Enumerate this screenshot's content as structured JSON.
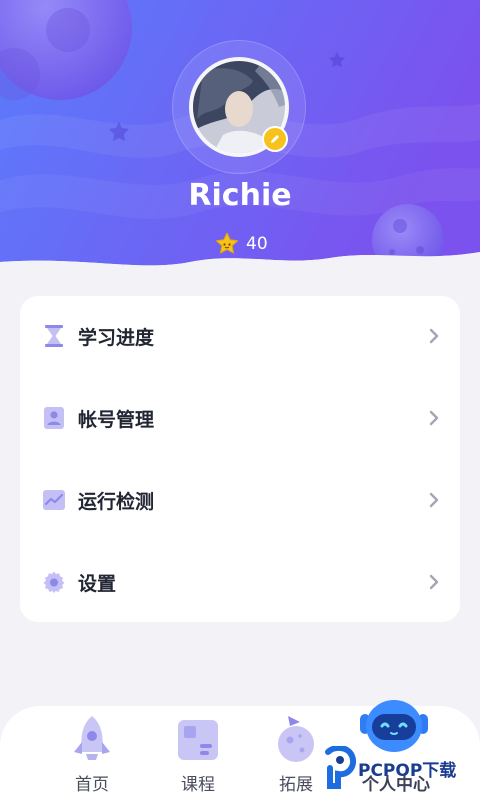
{
  "profile": {
    "username": "Richie",
    "stars": "40"
  },
  "menu": {
    "items": [
      {
        "label": "学习进度",
        "icon": "hourglass-icon"
      },
      {
        "label": "帐号管理",
        "icon": "user-card-icon"
      },
      {
        "label": "运行检测",
        "icon": "chart-line-icon"
      },
      {
        "label": "设置",
        "icon": "gear-icon"
      }
    ]
  },
  "nav": {
    "items": [
      {
        "label": "首页",
        "icon": "rocket-icon"
      },
      {
        "label": "课程",
        "icon": "course-book-icon"
      },
      {
        "label": "拓展",
        "icon": "planet-flag-icon"
      },
      {
        "label": "个人中心",
        "icon": "robot-icon",
        "active": true
      }
    ]
  },
  "watermark": {
    "text": "PCPOP下载"
  },
  "colors": {
    "header_gradient_start": "#5a78fb",
    "header_gradient_end": "#7b56ee",
    "accent_icon": "#b9b6f3",
    "badge": "#f7c21b"
  }
}
